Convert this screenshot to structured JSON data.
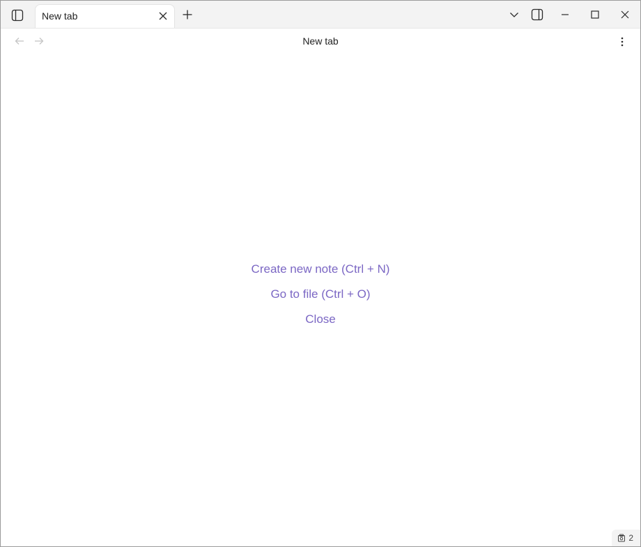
{
  "tabs": [
    {
      "title": "New tab",
      "active": true
    }
  ],
  "view": {
    "title": "New tab"
  },
  "empty_state": {
    "actions": [
      {
        "label": "Create new note (Ctrl + N)"
      },
      {
        "label": "Go to file (Ctrl + O)"
      },
      {
        "label": "Close"
      }
    ]
  },
  "status_bar": {
    "icon": "sync-icon",
    "count": "2"
  },
  "icons": {
    "sidebar_toggle": "sidebar-left-icon",
    "tab_close": "close-icon",
    "new_tab": "plus-icon",
    "tab_list": "chevron-down-icon",
    "right_sidebar_toggle": "sidebar-right-icon",
    "minimize": "minimize-icon",
    "maximize": "maximize-icon",
    "window_close": "close-icon",
    "back": "arrow-left-icon",
    "forward": "arrow-right-icon",
    "more": "more-vertical-icon"
  },
  "colors": {
    "accent": "#7b67c4",
    "tabbar_bg": "#f3f3f3",
    "content_bg": "#ffffff"
  }
}
